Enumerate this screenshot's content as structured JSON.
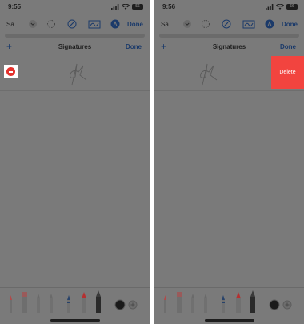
{
  "screens": [
    {
      "status": {
        "time": "9:55",
        "battery": "56"
      },
      "toolbar": {
        "doc_title": "Sa...",
        "done_label": "Done"
      },
      "sheet": {
        "add_label": "+",
        "title": "Signatures",
        "done_label": "Done"
      }
    },
    {
      "status": {
        "time": "9:56",
        "battery": "56"
      },
      "toolbar": {
        "doc_title": "Sa...",
        "done_label": "Done"
      },
      "sheet": {
        "add_label": "+",
        "title": "Signatures",
        "done_label": "Done"
      },
      "delete_label": "Delete"
    }
  ],
  "colors": {
    "overlay": "#7a7a7a",
    "delete_red": "#f2443f",
    "minus_red": "#e5322d",
    "accent": "#1b3a6a"
  },
  "icons": [
    "signal-icon",
    "wifi-icon",
    "battery-icon",
    "undo-icon",
    "lasso-icon",
    "pen-tool-icon",
    "markup-icon",
    "signature-icon"
  ]
}
